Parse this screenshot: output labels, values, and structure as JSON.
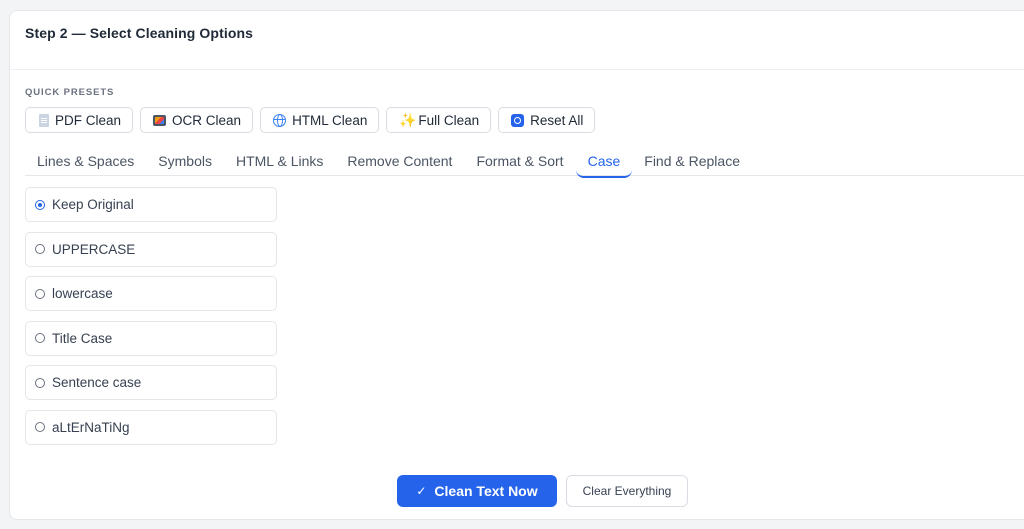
{
  "step_title": "Step 2 — Select Cleaning Options",
  "presets": {
    "label": "QUICK PRESETS",
    "items": [
      {
        "label": "PDF Clean",
        "icon": "document-icon"
      },
      {
        "label": "OCR Clean",
        "icon": "photo-icon"
      },
      {
        "label": "HTML Clean",
        "icon": "globe-icon"
      },
      {
        "label": "Full Clean",
        "icon": "sparkles-icon"
      },
      {
        "label": "Reset All",
        "icon": "reset-icon"
      }
    ]
  },
  "tabs": [
    {
      "label": "Lines & Spaces"
    },
    {
      "label": "Symbols"
    },
    {
      "label": "HTML & Links"
    },
    {
      "label": "Remove Content"
    },
    {
      "label": "Format & Sort"
    },
    {
      "label": "Case",
      "active": true
    },
    {
      "label": "Find & Replace"
    }
  ],
  "case_options": [
    {
      "label": "Keep Original",
      "checked": true
    },
    {
      "label": "UPPERCASE",
      "checked": false
    },
    {
      "label": "lowercase",
      "checked": false
    },
    {
      "label": "Title Case",
      "checked": false
    },
    {
      "label": "Sentence case",
      "checked": false
    },
    {
      "label": "aLtErNaTiNg",
      "checked": false
    }
  ],
  "actions": {
    "primary_label": "Clean Text Now",
    "secondary_label": "Clear Everything"
  },
  "colors": {
    "accent": "#2563eb",
    "border": "#e3e6ea",
    "text": "#1f2937"
  }
}
